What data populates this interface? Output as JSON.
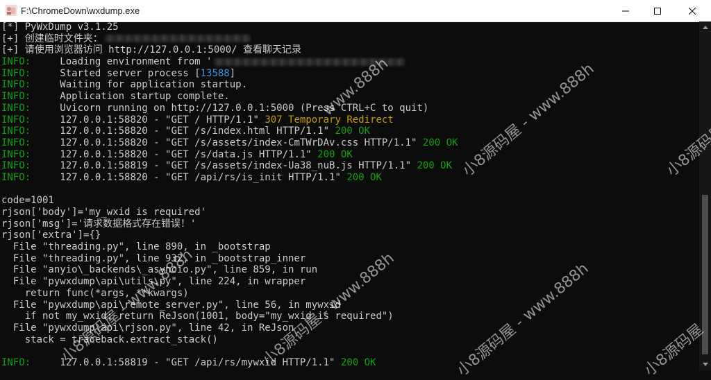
{
  "window": {
    "title": "F:\\ChromeDown\\wxdump.exe"
  },
  "console": {
    "lines": [
      {
        "parts": [
          {
            "t": "[*] PyWxDump v3.1.25"
          }
        ]
      },
      {
        "parts": [
          {
            "t": "[+] 创建临时文件夹："
          },
          {
            "t": "",
            "blur": true,
            "w": 210
          }
        ]
      },
      {
        "parts": [
          {
            "t": "[+] 请使用浏览器访问 http://127.0.0.1:5000/ 查看聊天记录"
          }
        ]
      },
      {
        "parts": [
          {
            "t": "INFO:",
            "c": "lvl"
          },
          {
            "t": "     Loading environment from '"
          },
          {
            "t": "",
            "blur": true,
            "w": 275
          }
        ]
      },
      {
        "parts": [
          {
            "t": "INFO:",
            "c": "lvl"
          },
          {
            "t": "     Started server process ["
          },
          {
            "t": "13588",
            "c": "b"
          },
          {
            "t": "]"
          }
        ]
      },
      {
        "parts": [
          {
            "t": "INFO:",
            "c": "lvl"
          },
          {
            "t": "     Waiting for application startup."
          }
        ]
      },
      {
        "parts": [
          {
            "t": "INFO:",
            "c": "lvl"
          },
          {
            "t": "     Application startup complete."
          }
        ]
      },
      {
        "parts": [
          {
            "t": "INFO:",
            "c": "lvl"
          },
          {
            "t": "     Uvicorn running on http://127.0.0.1:5000 (Press CTRL+C to quit)"
          }
        ]
      },
      {
        "parts": [
          {
            "t": "INFO:",
            "c": "lvl"
          },
          {
            "t": "     127.0.0.1:58820 - \"GET / HTTP/1.1\" "
          },
          {
            "t": "307 Temporary Redirect",
            "c": "y"
          }
        ]
      },
      {
        "parts": [
          {
            "t": "INFO:",
            "c": "lvl"
          },
          {
            "t": "     127.0.0.1:58820 - \"GET /s/index.html HTTP/1.1\" "
          },
          {
            "t": "200 OK",
            "c": "g"
          }
        ]
      },
      {
        "parts": [
          {
            "t": "INFO:",
            "c": "lvl"
          },
          {
            "t": "     127.0.0.1:58820 - \"GET /s/assets/index-CmTWrDAv.css HTTP/1.1\" "
          },
          {
            "t": "200 OK",
            "c": "g"
          }
        ]
      },
      {
        "parts": [
          {
            "t": "INFO:",
            "c": "lvl"
          },
          {
            "t": "     127.0.0.1:58820 - \"GET /s/data.js HTTP/1.1\" "
          },
          {
            "t": "200 OK",
            "c": "g"
          }
        ]
      },
      {
        "parts": [
          {
            "t": "INFO:",
            "c": "lvl"
          },
          {
            "t": "     127.0.0.1:58819 - \"GET /s/assets/index-Ua38_nuB.js HTTP/1.1\" "
          },
          {
            "t": "200 OK",
            "c": "g"
          }
        ]
      },
      {
        "parts": [
          {
            "t": "INFO:",
            "c": "lvl"
          },
          {
            "t": "     127.0.0.1:58820 - \"GET /api/rs/is_init HTTP/1.1\" "
          },
          {
            "t": "200 OK",
            "c": "g"
          }
        ]
      },
      {
        "parts": [
          {
            "t": ""
          }
        ]
      },
      {
        "parts": [
          {
            "t": "code=1001"
          }
        ]
      },
      {
        "parts": [
          {
            "t": "rjson['body']='my_wxid is required'"
          }
        ]
      },
      {
        "parts": [
          {
            "t": "rjson['msg']='请求数据格式存在错误！'"
          }
        ]
      },
      {
        "parts": [
          {
            "t": "rjson['extra']={}"
          }
        ]
      },
      {
        "parts": [
          {
            "t": "  File \"threading.py\", line 890, in _bootstrap"
          }
        ]
      },
      {
        "parts": [
          {
            "t": "  File \"threading.py\", line 932, in _bootstrap_inner"
          }
        ]
      },
      {
        "parts": [
          {
            "t": "  File \"anyio\\_backends\\_asyncio.py\", line 859, in run"
          }
        ]
      },
      {
        "parts": [
          {
            "t": "  File \"pywxdump\\api\\utils.py\", line 224, in wrapper"
          }
        ]
      },
      {
        "parts": [
          {
            "t": "    return func(*args, **kwargs)"
          }
        ]
      },
      {
        "parts": [
          {
            "t": "  File \"pywxdump\\api\\remote_server.py\", line 56, in mywxid"
          }
        ]
      },
      {
        "parts": [
          {
            "t": "    if not my_wxid: return ReJson(1001, body=\"my_wxid is required\")"
          }
        ]
      },
      {
        "parts": [
          {
            "t": "  File \"pywxdump\\api\\rjson.py\", line 42, in ReJson"
          }
        ]
      },
      {
        "parts": [
          {
            "t": "    stack = traceback.extract_stack()"
          }
        ]
      },
      {
        "parts": [
          {
            "t": ""
          }
        ]
      },
      {
        "parts": [
          {
            "t": "INFO:",
            "c": "lvl"
          },
          {
            "t": "     127.0.0.1:58819 - \"GET /api/rs/mywxid HTTP/1.1\" "
          },
          {
            "t": "200 OK",
            "c": "g"
          }
        ]
      }
    ]
  },
  "watermarks": [
    {
      "text": "www.888h"
    },
    {
      "text": "小8源码屋 - www.888h"
    },
    {
      "text": "小8源码屋"
    },
    {
      "text": "小8源码屋 - www.888h"
    },
    {
      "text": "小8源码屋 - www.888h"
    },
    {
      "text": "小8源码屋 - www.888h"
    },
    {
      "text": "小8源码屋"
    }
  ],
  "colors": {
    "info": "#13a10e",
    "ok": "#13a10e",
    "redirect": "#c19c00",
    "pid": "#3a96dd",
    "text": "#cccccc",
    "background": "#0c0c0c"
  },
  "icons": {
    "app": "console-app-icon",
    "minimize": "minimize-icon",
    "maximize": "maximize-icon",
    "close": "close-icon"
  }
}
